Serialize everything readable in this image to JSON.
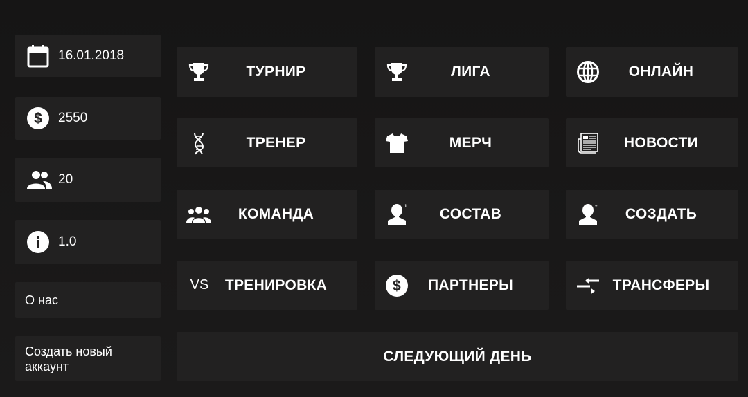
{
  "sidebar": {
    "date": "16.01.2018",
    "money": "2550",
    "players": "20",
    "version": "1.0",
    "about": "О нас",
    "new_account": "Создать новый аккаунт"
  },
  "menu": {
    "tournament": "ТУРНИР",
    "league": "ЛИГА",
    "online": "ОНЛАЙН",
    "coach": "ТРЕНЕР",
    "merch": "МЕРЧ",
    "news": "НОВОСТИ",
    "team": "КОМАНДА",
    "roster": "СОСТАВ",
    "create": "СОЗДАТЬ",
    "training": "ТРЕНИРОВКА",
    "training_icon_text": "VS",
    "partners": "ПАРТНЕРЫ",
    "transfers": "ТРАНСФЕРЫ",
    "next_day": "СЛЕДУЮЩИЙ ДЕНЬ"
  },
  "icons": {
    "date": "calendar-icon",
    "money": "dollar-icon",
    "players": "people-icon",
    "version": "info-icon",
    "tournament": "trophy-icon",
    "league": "trophy-icon",
    "online": "globe-icon",
    "coach": "dna-icon",
    "merch": "tshirt-icon",
    "news": "newspaper-icon",
    "team": "group-icon",
    "roster": "player-bust-icon",
    "create": "player-bust-icon",
    "partners": "dollar-icon",
    "transfers": "swap-arrows-icon"
  },
  "colors": {
    "background": "#1c1b1b",
    "tile": "#222121",
    "text": "#ffffff"
  }
}
